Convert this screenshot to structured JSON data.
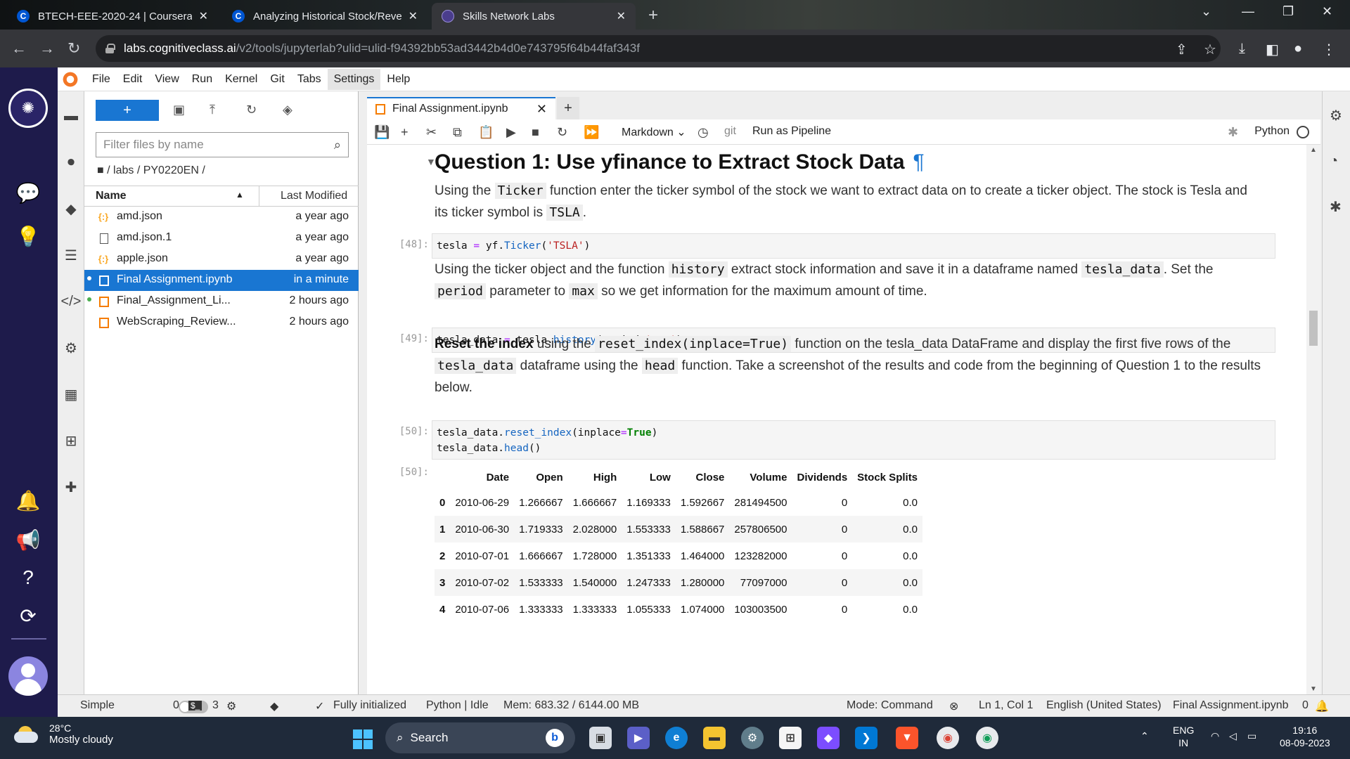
{
  "browser": {
    "tabs": [
      {
        "title": "BTECH-EEE-2020-24 | Coursera",
        "favicon": "C",
        "active": false
      },
      {
        "title": "Analyzing Historical Stock/Revenu",
        "favicon": "C",
        "active": false
      },
      {
        "title": "Skills Network Labs",
        "favicon": "S",
        "active": true
      }
    ],
    "url_host": "labs.cognitiveclass.ai",
    "url_path": "/v2/tools/jupyterlab?ulid=ulid-f94392bb53ad3442b4d0e743795f64b44faf343f"
  },
  "menu": [
    "File",
    "Edit",
    "View",
    "Run",
    "Kernel",
    "Git",
    "Tabs",
    "Settings",
    "Help"
  ],
  "filebrowser": {
    "new_label": "+",
    "filter_placeholder": "Filter files by name",
    "breadcrumb": "/ labs / PY0220EN /",
    "col_name": "Name",
    "col_modified": "Last Modified",
    "files": [
      {
        "name": "amd.json",
        "modified": "a year ago",
        "type": "json",
        "selected": false,
        "running": false
      },
      {
        "name": "amd.json.1",
        "modified": "a year ago",
        "type": "file",
        "selected": false,
        "running": false
      },
      {
        "name": "apple.json",
        "modified": "a year ago",
        "type": "json",
        "selected": false,
        "running": false
      },
      {
        "name": "Final Assignment.ipynb",
        "modified": "in a minute",
        "type": "notebook",
        "selected": true,
        "running": true
      },
      {
        "name": "Final_Assignment_Li...",
        "modified": "2 hours ago",
        "type": "notebook",
        "selected": false,
        "running": true
      },
      {
        "name": "WebScraping_Review...",
        "modified": "2 hours ago",
        "type": "notebook",
        "selected": false,
        "running": false
      }
    ]
  },
  "notebook": {
    "tab_title": "Final Assignment.ipynb",
    "cell_type": "Markdown",
    "git_label": "git",
    "pipeline_label": "Run as Pipeline",
    "kernel": "Python",
    "heading": "Question 1: Use yfinance to Extract Stock Data",
    "heading_anchor": "¶",
    "md1": {
      "a": "Using the ",
      "code1": "Ticker",
      "b": " function enter the ticker symbol of the stock we want to extract data on to create a ticker object. The stock is Tesla and its ticker symbol is ",
      "code2": "TSLA",
      "c": "."
    },
    "cell48": {
      "prompt": "[48]:"
    },
    "md2": {
      "a": "Using the ticker object and the function ",
      "code1": "history",
      "b": " extract stock information and save it in a dataframe named ",
      "code2": "tesla_data",
      "c": ". Set the ",
      "code3": "period",
      "d": " parameter to ",
      "code4": "max",
      "e": " so we get information for the maximum amount of time."
    },
    "cell49": {
      "prompt": "[49]:"
    },
    "md3": {
      "bold": "Reset the index",
      "a": " using the ",
      "code1": "reset_index(inplace=True)",
      "b": " function on the tesla_data DataFrame and display the first five rows of the ",
      "code2": "tesla_data",
      "c": " dataframe using the ",
      "code3": "head",
      "d": " function. Take a screenshot of the results and code from the beginning of Question 1 to the results below."
    },
    "cell50": {
      "prompt": "[50]:"
    },
    "out50": {
      "prompt": "[50]:"
    },
    "table": {
      "columns": [
        "",
        "Date",
        "Open",
        "High",
        "Low",
        "Close",
        "Volume",
        "Dividends",
        "Stock Splits"
      ],
      "rows": [
        [
          "0",
          "2010-06-29",
          "1.266667",
          "1.666667",
          "1.169333",
          "1.592667",
          "281494500",
          "0",
          "0.0"
        ],
        [
          "1",
          "2010-06-30",
          "1.719333",
          "2.028000",
          "1.553333",
          "1.588667",
          "257806500",
          "0",
          "0.0"
        ],
        [
          "2",
          "2010-07-01",
          "1.666667",
          "1.728000",
          "1.351333",
          "1.464000",
          "123282000",
          "0",
          "0.0"
        ],
        [
          "3",
          "2010-07-02",
          "1.533333",
          "1.540000",
          "1.247333",
          "1.280000",
          "77097000",
          "0",
          "0.0"
        ],
        [
          "4",
          "2010-07-06",
          "1.333333",
          "1.333333",
          "1.055333",
          "1.074000",
          "103003500",
          "0",
          "0.0"
        ]
      ]
    }
  },
  "status": {
    "mode_label": "Simple",
    "count_a": "0",
    "count_b": "3",
    "git_status": "Fully initialized",
    "kernel_status": "Python | Idle",
    "memory": "Mem: 683.32 / 6144.00 MB",
    "mode": "Mode: Command",
    "position": "Ln 1, Col 1",
    "language": "English (United States)",
    "file": "Final Assignment.ipynb",
    "notifications": "0"
  },
  "taskbar": {
    "temp": "28°C",
    "weather": "Mostly cloudy",
    "search_label": "Search",
    "lang_top": "ENG",
    "lang_bottom": "IN",
    "time": "19:16",
    "date": "08-09-2023"
  }
}
